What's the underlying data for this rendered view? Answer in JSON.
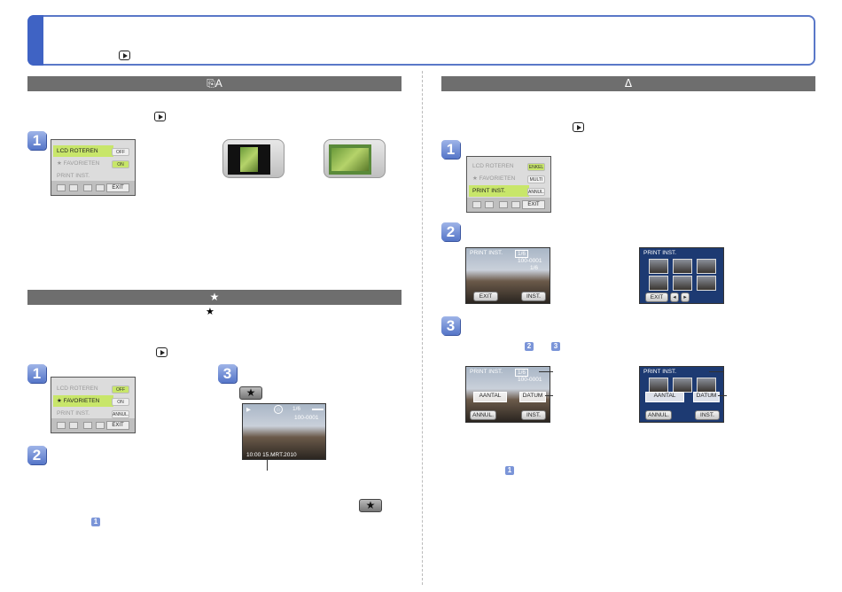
{
  "header": {
    "play_icon": "playback-icon"
  },
  "left": {
    "rotate_bar": {
      "icon": "rotate-lcd-icon",
      "glyph": "⎘A"
    },
    "rotate_menu": {
      "rows": [
        {
          "label": "LCD ROTEREN",
          "pill": "OFF",
          "active": true
        },
        {
          "label": "★ FAVORIETEN",
          "pill": "ON",
          "active": false
        },
        {
          "label": "PRINT INST.",
          "pill": "",
          "active": false
        }
      ],
      "exit": "EXIT"
    },
    "fav_bar": {
      "icon": "star-icon",
      "glyph": "★"
    },
    "fav_star_inline": "★",
    "fav_menu": {
      "rows": [
        {
          "label": "LCD ROTEREN",
          "pill": "OFF",
          "active": false
        },
        {
          "label": "★ FAVORIETEN",
          "pill": "ON",
          "active": true
        },
        {
          "label": "PRINT INST.",
          "pill": "ANNUL.",
          "active": false
        }
      ],
      "exit": "EXIT"
    },
    "fav_photo": {
      "top_left": "▶",
      "top_mid": "1/6",
      "top_right": "▬▬",
      "file": "100-0001",
      "bottom": "10:00 15.MRT.2010"
    },
    "steps": [
      "1",
      "1",
      "2",
      "3"
    ],
    "mini_step": "1"
  },
  "right": {
    "print_bar": {
      "icon": "print-set-icon",
      "glyph": "ᐃ"
    },
    "print_menu": {
      "rows": [
        {
          "label": "LCD ROTEREN",
          "pill": "ENKEL",
          "active": false
        },
        {
          "label": "★ FAVORIETEN",
          "pill": "MULTI",
          "active": false
        },
        {
          "label": "PRINT INST.",
          "pill": "ANNUL.",
          "active": true
        }
      ],
      "exit": "EXIT"
    },
    "photo_single": {
      "title": "PRINT INST.",
      "badge": "1/6",
      "file": "100-0001",
      "count": "1/6",
      "exit": "EXIT",
      "set": "INST."
    },
    "photo_grid": {
      "title": "PRINT INST.",
      "exit": "EXIT"
    },
    "photo_single_2": {
      "title": "PRINT INST.",
      "badge": "1/6",
      "file": "100-0001",
      "aantal": "AANTAL",
      "datum": "DATUM",
      "cancel": "ANNUL.",
      "set": "INST."
    },
    "photo_grid_2": {
      "title": "PRINT INST.",
      "aantal": "AANTAL",
      "datum": "DATUM",
      "cancel": "ANNUL.",
      "set": "INST."
    },
    "steps": [
      "1",
      "2",
      "3"
    ],
    "mini_steps": [
      "2",
      "3",
      "1"
    ]
  }
}
